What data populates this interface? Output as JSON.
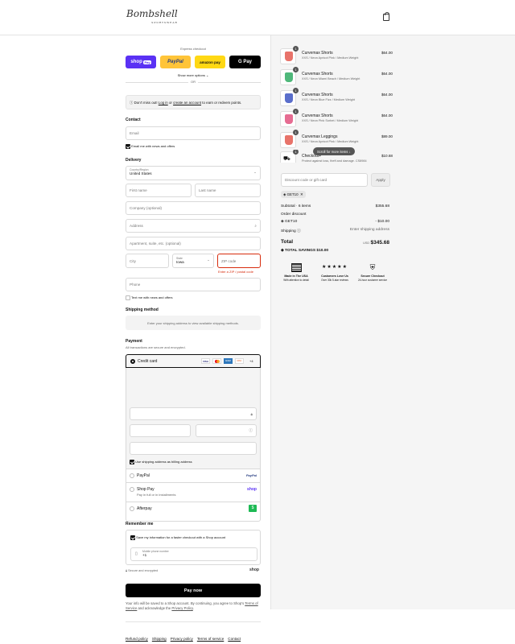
{
  "header": {
    "logo": "Bombshell",
    "logo_sub": "SPORTSWEAR"
  },
  "express": {
    "title": "Express checkout",
    "shop_pay": "shop",
    "shop_pay_badge": "Pay",
    "paypal": "PayPal",
    "amazon": "amazon pay",
    "gpay": "G Pay",
    "more": "Show more options",
    "or": "OR"
  },
  "login": {
    "prefix": "Don't miss out!",
    "login": "Log in",
    "or": "or",
    "create": "create an account",
    "suffix": "to earn or redeem points."
  },
  "contact": {
    "title": "Contact",
    "email_placeholder": "Email",
    "news": "Email me with news and offers"
  },
  "delivery": {
    "title": "Delivery",
    "country_label": "Country/Region",
    "country": "United States",
    "first": "First name",
    "last": "Last name",
    "company": "Company (optional)",
    "address": "Address",
    "apt": "Apartment, suite, etc. (optional)",
    "city": "City",
    "state_label": "State",
    "state": "Iowa",
    "zip": "ZIP code",
    "zip_error": "Enter a ZIP / postal code",
    "phone": "Phone",
    "text_me": "Text me with news and offers"
  },
  "shipping": {
    "title": "Shipping method",
    "note": "Enter your shipping address to view available shipping methods."
  },
  "payment": {
    "title": "Payment",
    "subtitle": "All transactions are secure and encrypted.",
    "credit": "Credit card",
    "cards": [
      "VISA",
      "MC",
      "AMEX",
      "DISC",
      "+4"
    ],
    "billing": "Use shipping address as billing address",
    "paypal": "PayPal",
    "paypal_logo": "PayPal",
    "shoppay": "Shop Pay",
    "shoppay_sub": "Pay in full or in installments",
    "shoppay_logo": "shop",
    "afterpay": "Afterpay",
    "afterpay_logo": "$"
  },
  "remember": {
    "title": "Remember me",
    "save": "Save my information for a faster checkout with a Shop account",
    "mobile_label": "Mobile phone number",
    "mobile": "+1",
    "secure": "Secure and encrypted",
    "shop": "shop"
  },
  "pay_button": "Pay now",
  "disclaimer": {
    "text": "Your info will be saved to a Shop account. By continuing, you agree to Shop's",
    "terms": "Terms of Service",
    "and": "and acknowledge the",
    "privacy": "Privacy Policy"
  },
  "footer": [
    "Refund policy",
    "Shipping",
    "Privacy policy",
    "Terms of service",
    "Contact"
  ],
  "cart": {
    "items": [
      {
        "qty": "1",
        "name": "Curvemax Shorts",
        "variant": "XXS / Neon Apricot Pink / Medium Weight",
        "price": "$64.00",
        "color": "#e8736a"
      },
      {
        "qty": "1",
        "name": "Curvemax Shorts",
        "variant": "XXS / Neon Miami Beach / Medium Weight",
        "price": "$64.00",
        "color": "#4fb87a"
      },
      {
        "qty": "1",
        "name": "Curvemax Shorts",
        "variant": "XXS / Neon Blue Fizz / Medium Weight",
        "price": "$64.00",
        "color": "#5a6ecb"
      },
      {
        "qty": "1",
        "name": "Curvemax Shorts",
        "variant": "XXS / Neon Pink Sorbet / Medium Weight",
        "price": "$64.00",
        "color": "#e66c92"
      },
      {
        "qty": "1",
        "name": "Curvemax Leggings",
        "variant": "XXS / Neon Apricot Pink / Medium Weight",
        "price": "$89.00",
        "color": "#e8736a"
      },
      {
        "qty": "1",
        "name": "Checkout+",
        "variant": "Protect against loss, theft and damage. CS8984",
        "price": "$10.68",
        "color": "#ffffff"
      }
    ],
    "scroll_hint": "Scroll for more items",
    "discount_placeholder": "Discount code or gift card",
    "apply": "Apply",
    "code": "GET10",
    "subtotal_label": "Subtotal · 6 items",
    "subtotal": "$355.68",
    "order_discount": "Order discount",
    "code_line": "GET10",
    "code_amount": "- $10.00",
    "shipping_label": "Shipping",
    "shipping_value": "Enter shipping address",
    "total_label": "Total",
    "currency": "USD",
    "total": "$345.68",
    "savings": "TOTAL SAVINGS $10.00",
    "badges": [
      {
        "title": "Made in The USA",
        "sub": "With attention to detail"
      },
      {
        "title": "Customers Love Us",
        "sub": "Over 30k 5-star reviews",
        "stars": "★★★★★"
      },
      {
        "title": "Secure Checkout",
        "sub": "24-hour customer service"
      }
    ]
  },
  "colors": {
    "shop_pay": "#5a31f4",
    "paypal": "#ffc439",
    "amazon": "#ffd814",
    "error": "#d72c0d",
    "afterpay": "#1db954"
  }
}
